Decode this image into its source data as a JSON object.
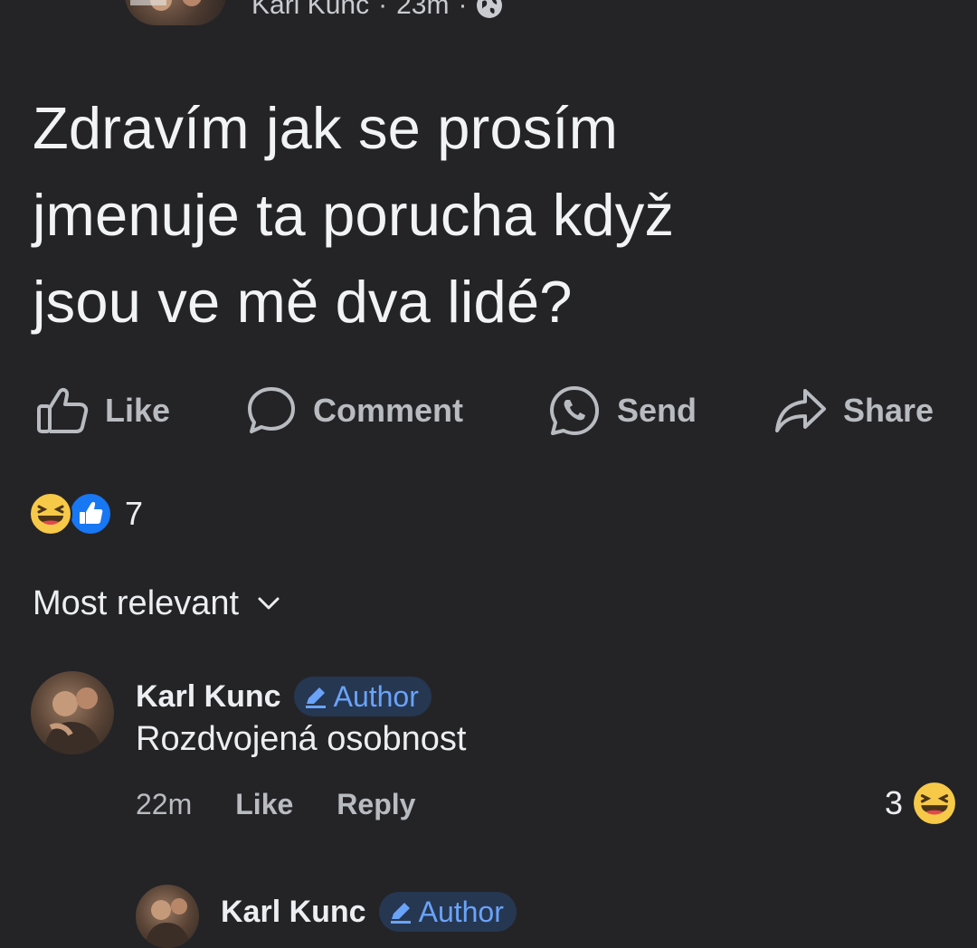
{
  "header": {
    "author": "Karl Kunc",
    "separator": "·",
    "time": "23m",
    "separator2": "·",
    "audience_icon": "globe-icon"
  },
  "post": {
    "text_lines": [
      "Zdravím jak se prosím",
      "jmenuje ta porucha když",
      "jsou ve mě dva lidé?"
    ]
  },
  "actions": {
    "like": "Like",
    "comment": "Comment",
    "send": "Send",
    "share": "Share"
  },
  "reactions": {
    "icons": [
      "haha-emoji-icon",
      "like-reaction-icon"
    ],
    "count": "7"
  },
  "sort": {
    "label": "Most relevant"
  },
  "comments": [
    {
      "author": "Karl Kunc",
      "badge": "Author",
      "text": "Rozdvojená osobnost",
      "time": "22m",
      "like": "Like",
      "reply": "Reply",
      "reaction_count": "3"
    },
    {
      "author": "Karl Kunc",
      "badge": "Author"
    }
  ],
  "colors": {
    "background": "#242427",
    "text": "#e4e6eb",
    "muted": "#b8bbc0",
    "badge_bg": "#263752",
    "badge_text": "#6aa3f8",
    "like_blue": "#1877f2",
    "haha_yellow": "#f7c948"
  }
}
